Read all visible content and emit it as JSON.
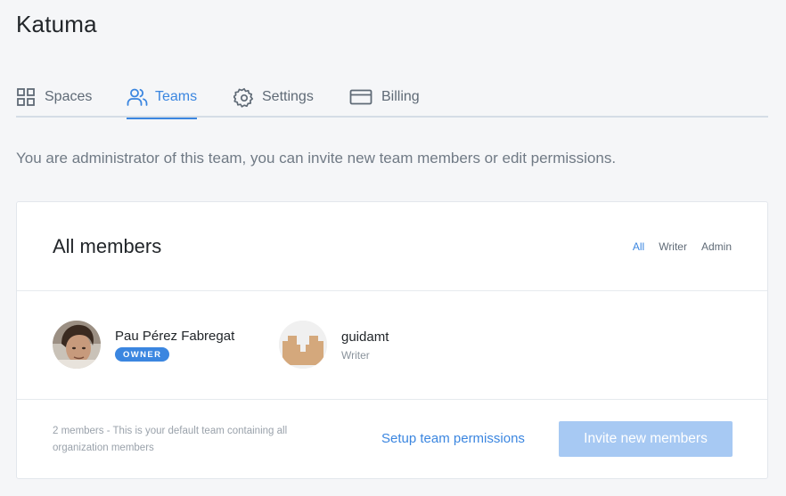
{
  "app": {
    "title": "Katuma"
  },
  "tabs": [
    {
      "label": "Spaces",
      "icon": "grid-icon",
      "active": false
    },
    {
      "label": "Teams",
      "icon": "users-icon",
      "active": true
    },
    {
      "label": "Settings",
      "icon": "gear-icon",
      "active": false
    },
    {
      "label": "Billing",
      "icon": "credit-card-icon",
      "active": false
    }
  ],
  "intro": "You are administrator of this team, you can invite new team members or edit permissions.",
  "card": {
    "title": "All members",
    "filters": [
      "All",
      "Writer",
      "Admin"
    ],
    "active_filter": "All",
    "members": [
      {
        "name": "Pau Pérez Fabregat",
        "badge": "OWNER",
        "avatar": "photo-avatar"
      },
      {
        "name": "guidamt",
        "role": "Writer",
        "avatar": "identicon-avatar"
      }
    ],
    "footer": {
      "note": "2 members - This is your default team containing all organization members",
      "setup_link": "Setup team permissions",
      "invite_button": "Invite new members"
    }
  },
  "colors": {
    "accent": "#3b86e0",
    "invite_button_bg": "#a7c9f3",
    "page_bg": "#f5f6f8",
    "identicon": "#d4a87c"
  }
}
